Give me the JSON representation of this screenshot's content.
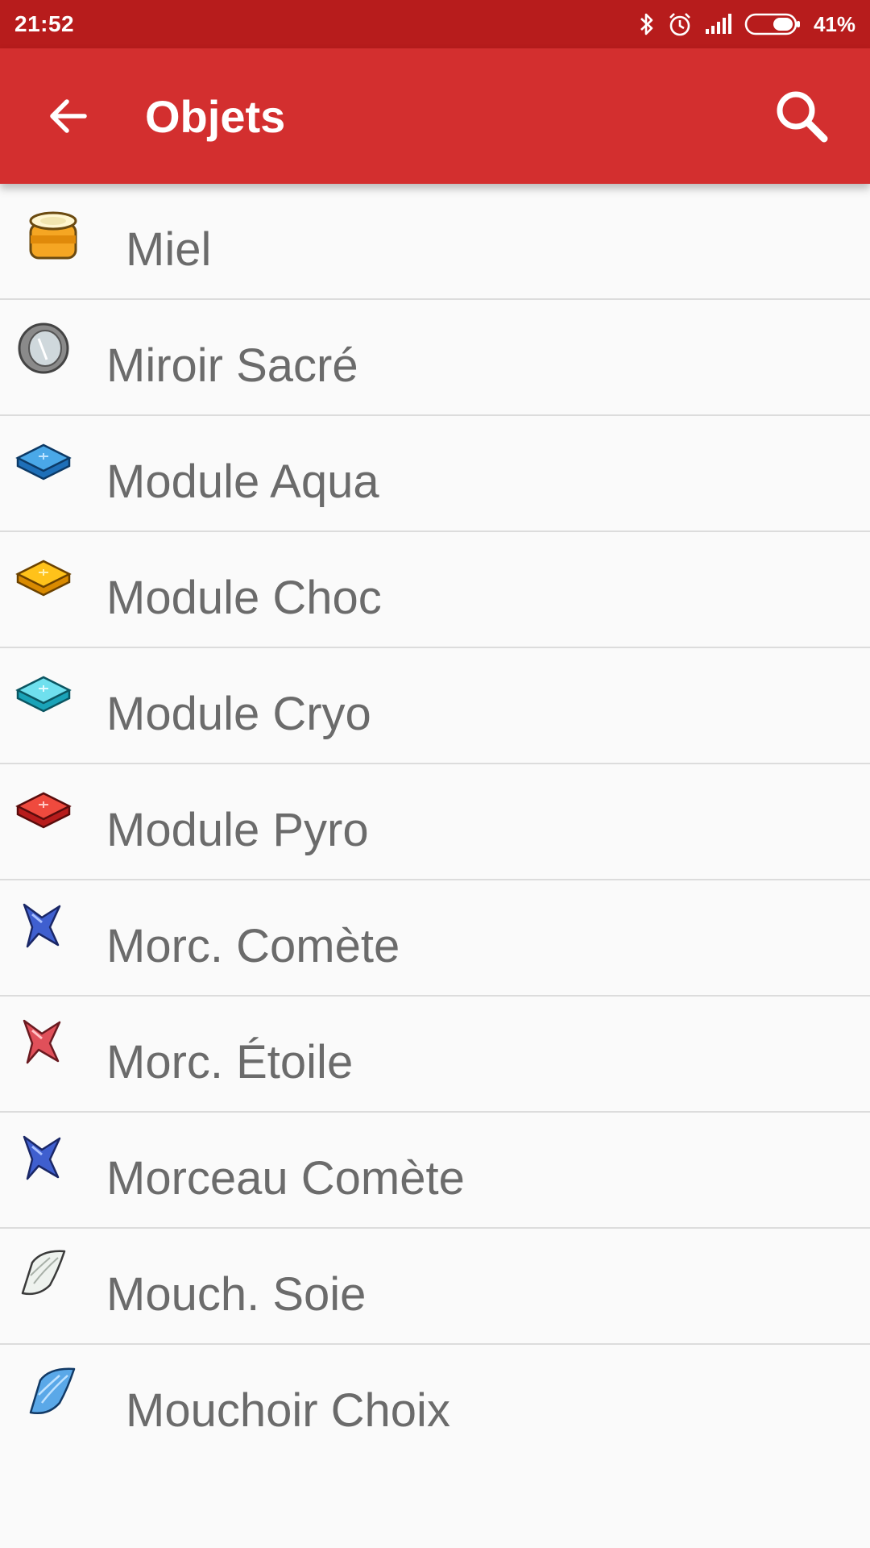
{
  "status_bar": {
    "time": "21:52",
    "battery": "41%",
    "icons": [
      "bluetooth-icon",
      "alarm-icon",
      "signal-icon",
      "battery-icon"
    ]
  },
  "app_bar": {
    "title": "Objets",
    "back_icon": "arrow-back-icon",
    "search_icon": "search-icon",
    "colors": {
      "status": "#b71c1c",
      "toolbar": "#d32f2f"
    }
  },
  "items": [
    {
      "label": "Miel",
      "icon": "honey-jar-icon"
    },
    {
      "label": "Miroir Sacré",
      "icon": "mirror-icon"
    },
    {
      "label": "Module Aqua",
      "icon": "module-blue-icon"
    },
    {
      "label": "Module Choc",
      "icon": "module-yellow-icon"
    },
    {
      "label": "Module Cryo",
      "icon": "module-cyan-icon"
    },
    {
      "label": "Module Pyro",
      "icon": "module-red-icon"
    },
    {
      "label": "Morc. Comète",
      "icon": "shard-blue-icon"
    },
    {
      "label": "Morc. Étoile",
      "icon": "shard-red-icon"
    },
    {
      "label": "Morceau Comète",
      "icon": "shard-blue-icon"
    },
    {
      "label": "Mouch. Soie",
      "icon": "scarf-white-icon"
    },
    {
      "label": "Mouchoir Choix",
      "icon": "scarf-blue-icon"
    }
  ]
}
